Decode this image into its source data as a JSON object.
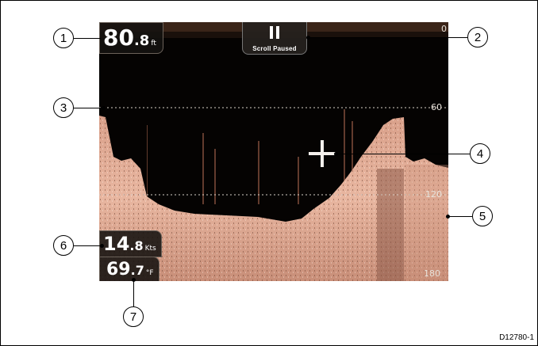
{
  "overlays": {
    "depth": {
      "whole": "80",
      "decimal": ".8",
      "unit": "ft"
    },
    "scroll": {
      "label": "Scroll Paused",
      "icon": "pause-icon"
    },
    "speed": {
      "whole": "14",
      "decimal": ".8",
      "unit": "Kts"
    },
    "temperature": {
      "whole": "69",
      "decimal": ".7",
      "unit": "°F"
    }
  },
  "depth_scale": {
    "ticks": [
      "0",
      "60",
      "120",
      "180"
    ]
  },
  "callouts": [
    "1",
    "2",
    "3",
    "4",
    "5",
    "6",
    "7"
  ],
  "reference_code": "D12780-1",
  "colors": {
    "sonar_background": "#050302",
    "bottom_echo": "#e8b6a0",
    "overlay_background": "#141210"
  }
}
